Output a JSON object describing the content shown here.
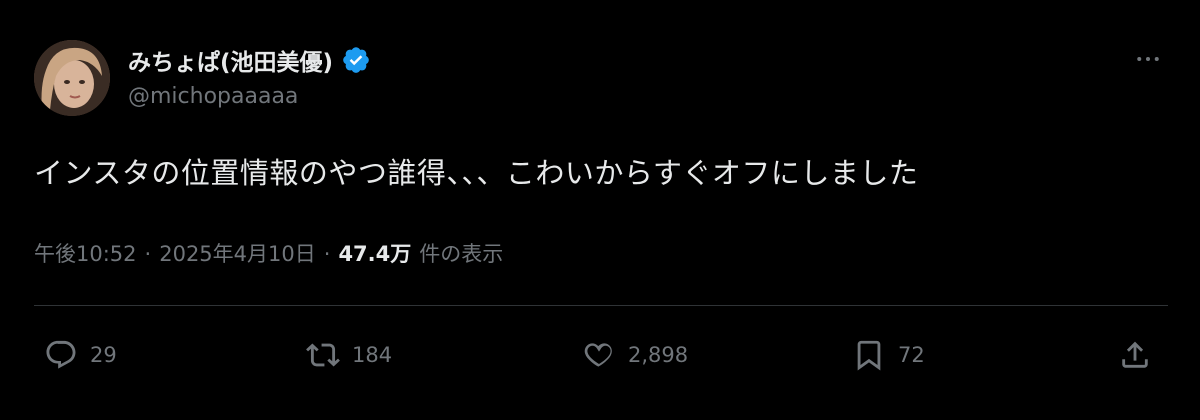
{
  "author": {
    "display_name": "みちょぱ(池田美優)",
    "handle": "@michopaaaaa",
    "verified": true
  },
  "tweet": {
    "text": "インスタの位置情報のやつ誰得、、、こわいからすぐオフにしました"
  },
  "meta": {
    "time": "午後10:52",
    "separator": "·",
    "date": "2025年4月10日",
    "views_count": "47.4万",
    "views_label": "件の表示"
  },
  "actions": {
    "replies": "29",
    "retweets": "184",
    "likes": "2,898",
    "bookmarks": "72"
  },
  "colors": {
    "background": "#000000",
    "text_primary": "#e7e9ea",
    "text_secondary": "#71767b",
    "divider": "#2f3336",
    "verified_badge": "#1d9bf0"
  },
  "icons": {
    "verified": "verified-badge-icon",
    "more": "more-horizontal-icon",
    "reply": "reply-bubble-icon",
    "retweet": "retweet-icon",
    "like": "heart-icon",
    "bookmark": "bookmark-icon",
    "share": "share-upload-icon"
  }
}
